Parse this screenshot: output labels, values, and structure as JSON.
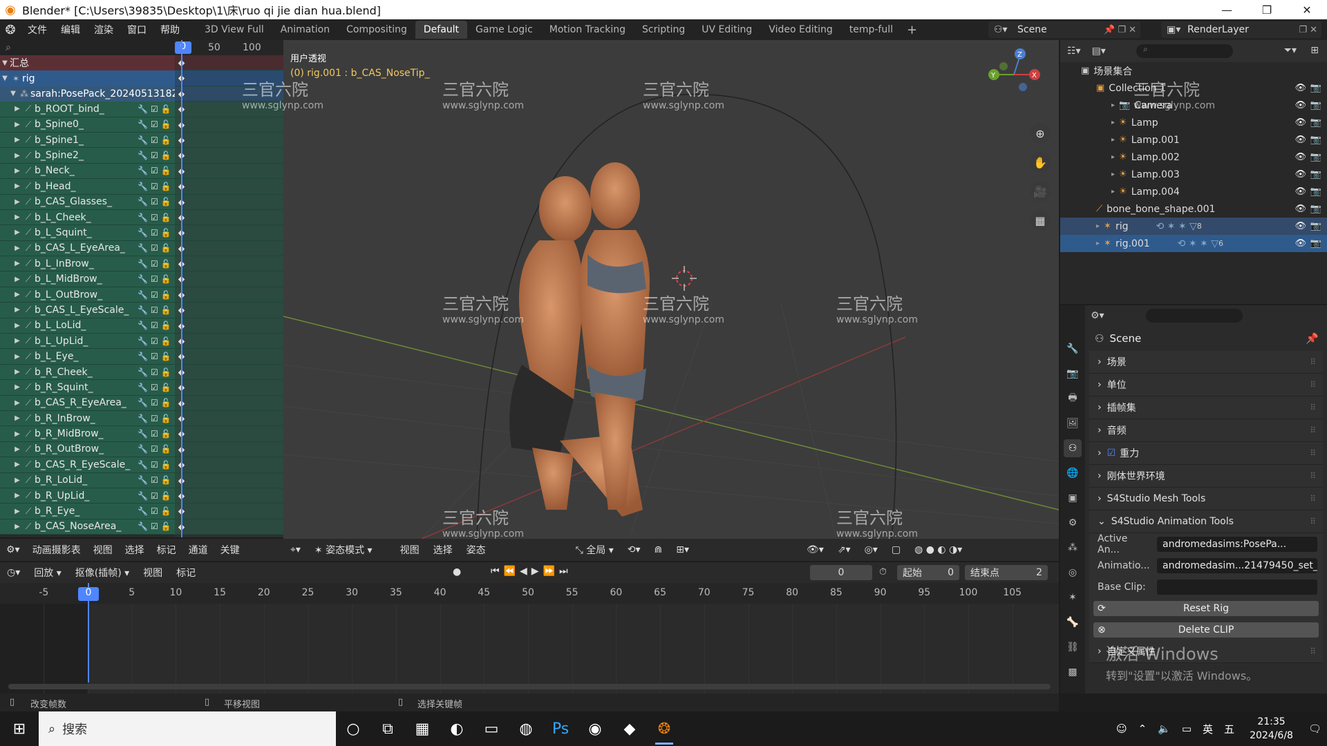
{
  "window": {
    "title": "Blender* [C:\\Users\\39835\\Desktop\\1\\床\\ruo qi jie dian hua.blend]",
    "controls": [
      "—",
      "❐",
      "✕"
    ]
  },
  "menubar": {
    "menus": [
      "文件",
      "编辑",
      "渲染",
      "窗口",
      "帮助"
    ],
    "workspaces": [
      "3D View Full",
      "Animation",
      "Compositing",
      "Default",
      "Game Logic",
      "Motion Tracking",
      "Scripting",
      "UV Editing",
      "Video Editing",
      "temp-full"
    ],
    "active_workspace": "Default",
    "add_label": "+",
    "scene": "Scene",
    "render_layer": "RenderLayer"
  },
  "channels": {
    "ruler_values": [
      "0",
      "50",
      "100"
    ],
    "summary": "汇总",
    "rig": "rig",
    "action": "sarah:PosePack_20240513182",
    "bones": [
      "b_ROOT_bind_",
      "b_Spine0_",
      "b_Spine1_",
      "b_Spine2_",
      "b_Neck_",
      "b_Head_",
      "b_CAS_Glasses_",
      "b_L_Cheek_",
      "b_L_Squint_",
      "b_CAS_L_EyeArea_",
      "b_L_InBrow_",
      "b_L_MidBrow_",
      "b_L_OutBrow_",
      "b_CAS_L_EyeScale_",
      "b_L_LoLid_",
      "b_L_UpLid_",
      "b_L_Eye_",
      "b_R_Cheek_",
      "b_R_Squint_",
      "b_CAS_R_EyeArea_",
      "b_R_InBrow_",
      "b_R_MidBrow_",
      "b_R_OutBrow_",
      "b_CAS_R_EyeScale_",
      "b_R_LoLid_",
      "b_R_UpLid_",
      "b_R_Eye_",
      "b_CAS_NoseArea_"
    ]
  },
  "viewport": {
    "title": "用户透视",
    "subtitle": "(0) rig.001 : b_CAS_NoseTip_",
    "header": {
      "mode": "姿态模式",
      "menus": [
        "视图",
        "选择",
        "姿态"
      ],
      "transform": "全局"
    }
  },
  "dopesheet_header": {
    "editor": "动画摄影表",
    "menus": [
      "视图",
      "选择",
      "标记",
      "通道",
      "关键"
    ]
  },
  "timeline": {
    "header": {
      "playback": "回放",
      "keying": "抠像(插帧)",
      "menus": [
        "视图",
        "标记"
      ],
      "current_frame": "0",
      "start_label": "起始",
      "start": "0",
      "end_label": "结束点",
      "end": "2"
    },
    "current": "0",
    "ticks": [
      "-5",
      "0",
      "5",
      "10",
      "15",
      "20",
      "25",
      "30",
      "35",
      "40",
      "45",
      "50",
      "55",
      "60",
      "65",
      "70",
      "75",
      "80",
      "85",
      "90",
      "95",
      "100",
      "105"
    ]
  },
  "statusbar": {
    "items": [
      "改变帧数",
      "平移视图",
      "选择关键帧"
    ]
  },
  "outliner": {
    "scene_collection": "场景集合",
    "items": [
      {
        "name": "Collection 1",
        "level": 1
      },
      {
        "name": "Camera",
        "level": 2
      },
      {
        "name": "Lamp",
        "level": 2
      },
      {
        "name": "Lamp.001",
        "level": 2
      },
      {
        "name": "Lamp.002",
        "level": 2
      },
      {
        "name": "Lamp.003",
        "level": 2
      },
      {
        "name": "Lamp.004",
        "level": 2
      },
      {
        "name": "bone_bone_shape.001",
        "level": 1
      },
      {
        "name": "rig",
        "level": 1
      },
      {
        "name": "rig.001",
        "level": 1
      }
    ],
    "rig_count": "8",
    "rig001_count": "6"
  },
  "properties": {
    "title": "Scene",
    "panels": [
      "场景",
      "单位",
      "插帧集",
      "音频",
      "重力",
      "刚体世界环境",
      "S4Studio Mesh Tools",
      "S4Studio Animation Tools"
    ],
    "fields": [
      {
        "label": "Active An...",
        "value": "andromedasims:PosePa..."
      },
      {
        "label": "Animatio...",
        "value": "andromedasim...21479450_set_3"
      },
      {
        "label": "Base Clip:",
        "value": ""
      }
    ],
    "buttons": [
      "Reset Rig",
      "Delete CLIP"
    ],
    "custom_props": "自定义属性",
    "activate_windows": "激活 Windows",
    "activate_windows_sub": "转到\"设置\"以激活 Windows。"
  },
  "taskbar": {
    "search": "搜索",
    "clock_time": "21:35",
    "clock_date": "2024/6/8",
    "ime": "英",
    "ime2": "五"
  },
  "watermark": {
    "text": "三官六院",
    "url": "www.sglynp.com"
  },
  "colors": {
    "accent": "#4f86ff",
    "bone_row": "#275c4a",
    "selected": "#2f5a8c",
    "summary": "#5c2f34"
  }
}
